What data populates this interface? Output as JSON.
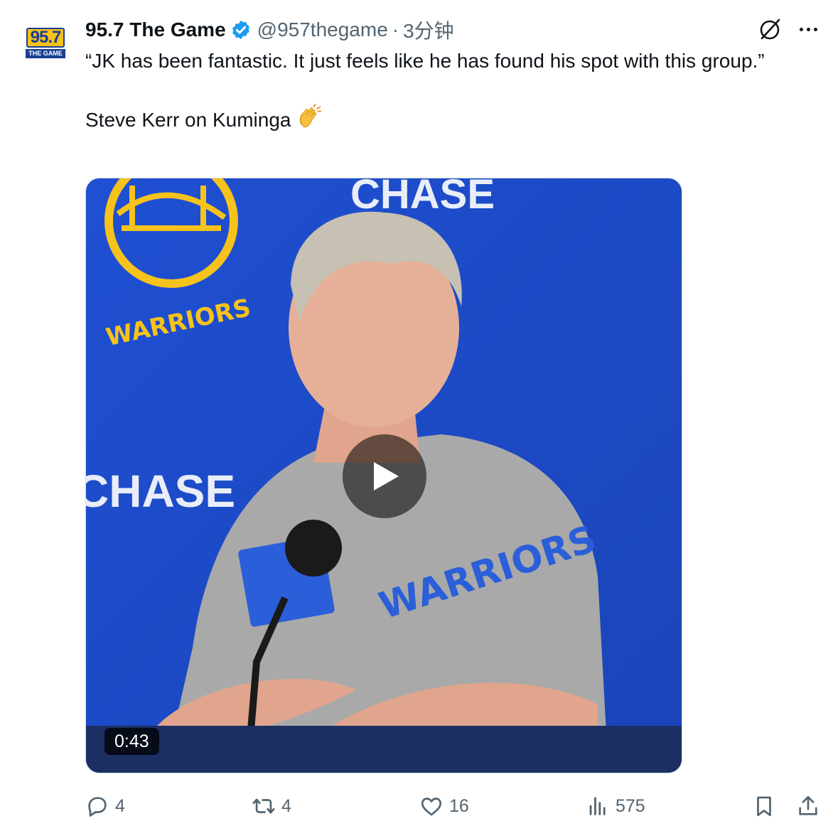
{
  "account": {
    "name": "95.7 The Game",
    "handle": "@957thegame",
    "separator": "·",
    "timestamp": "3分钟",
    "verified": true,
    "avatar_logo_main": "95.7",
    "avatar_logo_sub": "THE GAME",
    "brand_color": "#1d9bf0"
  },
  "tweet": {
    "line1": "“JK has been fantastic. It just feels like he has found his spot with this group.”",
    "line2": "Steve Kerr on Kuminga",
    "emoji": "clapping-hands-emoji"
  },
  "media": {
    "type": "video",
    "duration": "0:43",
    "backdrop_sponsor": "CHASE",
    "backdrop_team": "WARRIORS",
    "shirt_text": "WARRIORS"
  },
  "actions": {
    "replies": "4",
    "reposts": "4",
    "likes": "16",
    "views": "575"
  },
  "icons": {
    "grok": "grok-icon",
    "more": "more-icon",
    "reply": "reply-icon",
    "repost": "repost-icon",
    "like": "like-icon",
    "views": "views-icon",
    "bookmark": "bookmark-icon",
    "share": "share-icon"
  }
}
